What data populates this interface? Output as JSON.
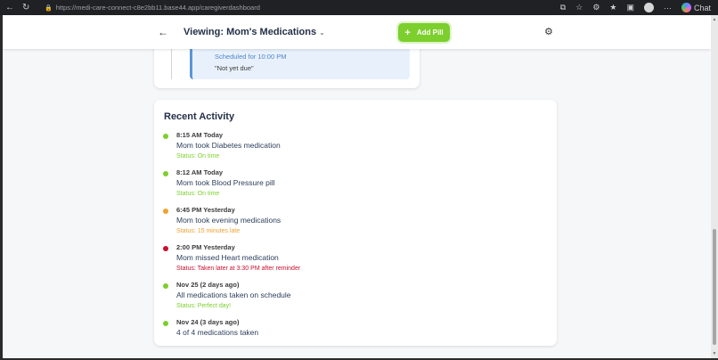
{
  "browser": {
    "url": "https://medi-care-connect-c8e2bb11.base44.app/caregiverdashboard",
    "chat_label": "Chat"
  },
  "header": {
    "title": "Viewing: Mom's Medications",
    "add_button_label": "Add Pill"
  },
  "upper_card": {
    "scheduled": "Scheduled for 10:00 PM",
    "note": "\"Not yet due\""
  },
  "activity": {
    "title": "Recent Activity",
    "items": [
      {
        "time": "8:15 AM Today",
        "description": "Mom took Diabetes medication",
        "status": "Status: On time",
        "color": "#7ccf2c"
      },
      {
        "time": "8:12 AM Today",
        "description": "Mom took Blood Pressure pill",
        "status": "Status: On time",
        "color": "#7ccf2c"
      },
      {
        "time": "6:45 PM Yesterday",
        "description": "Mom took evening medications",
        "status": "Status: 15 minutes late",
        "color": "#f0a22e"
      },
      {
        "time": "2:00 PM Yesterday",
        "description": "Mom missed Heart medication",
        "status": "Status: Taken later at 3:30 PM after reminder",
        "color": "#c8102e"
      },
      {
        "time": "Nov 25 (2 days ago)",
        "description": "All medications taken on schedule",
        "status": "Status: Perfect day!",
        "color": "#7ccf2c"
      },
      {
        "time": "Nov 24 (3 days ago)",
        "description": "4 of 4 medications taken",
        "status": "",
        "color": "#7ccf2c"
      }
    ]
  },
  "colors": {
    "accent_green": "#7ccf2c",
    "status_ok": "#7ccf2c",
    "status_late": "#f0a22e",
    "status_missed": "#c8102e",
    "title_navy": "#243047"
  }
}
